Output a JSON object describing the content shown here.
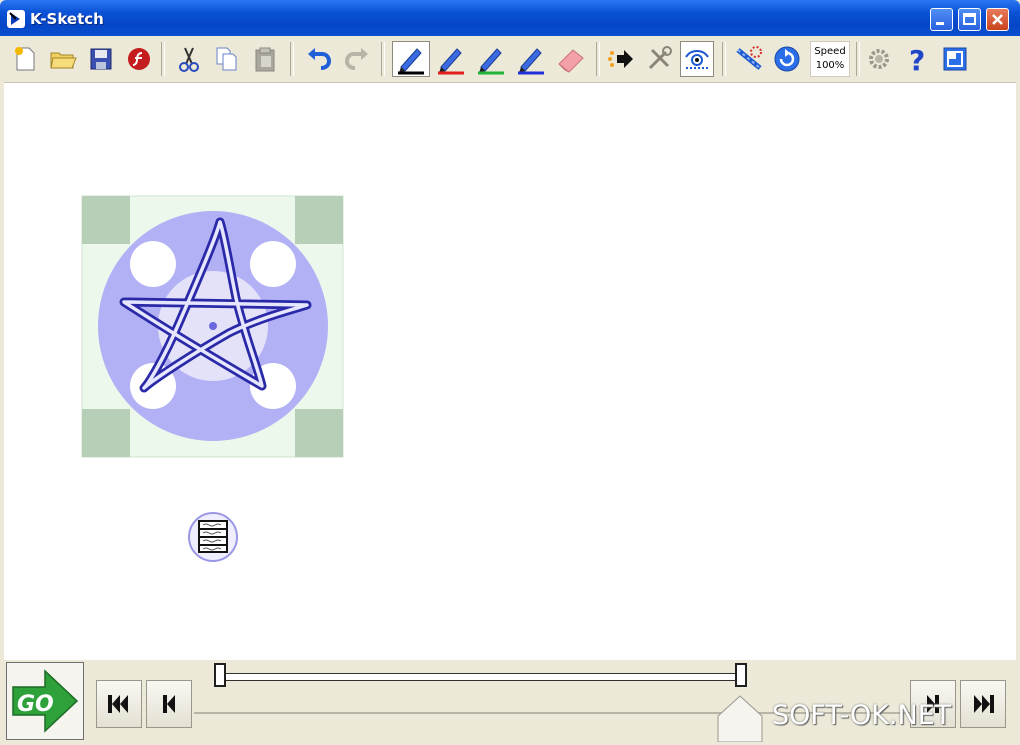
{
  "window": {
    "title": "K-Sketch"
  },
  "toolbar": {
    "buttons": [
      {
        "name": "new",
        "icon": "new-file-icon"
      },
      {
        "name": "open",
        "icon": "open-folder-icon"
      },
      {
        "name": "save",
        "icon": "save-disk-icon"
      },
      {
        "name": "export-flash",
        "icon": "flash-icon"
      },
      {
        "name": "cut",
        "icon": "scissors-icon"
      },
      {
        "name": "copy",
        "icon": "copy-icon"
      },
      {
        "name": "paste",
        "icon": "paste-icon"
      },
      {
        "name": "undo",
        "icon": "undo-icon"
      },
      {
        "name": "redo",
        "icon": "redo-icon"
      },
      {
        "name": "pen-black",
        "icon": "pen-black-icon"
      },
      {
        "name": "pen-red",
        "icon": "pen-red-icon"
      },
      {
        "name": "pen-green",
        "icon": "pen-green-icon"
      },
      {
        "name": "pen-blue",
        "icon": "pen-blue-icon"
      },
      {
        "name": "eraser",
        "icon": "eraser-icon"
      },
      {
        "name": "insert-key",
        "icon": "insert-arrow-icon"
      },
      {
        "name": "tools",
        "icon": "tools-icon"
      },
      {
        "name": "show-paths",
        "icon": "eye-path-icon"
      },
      {
        "name": "select-motion",
        "icon": "motion-icon"
      },
      {
        "name": "refresh",
        "icon": "refresh-icon"
      },
      {
        "name": "settings",
        "icon": "gear-icon"
      },
      {
        "name": "help",
        "icon": "help-icon"
      },
      {
        "name": "fullscreen",
        "icon": "fullscreen-icon"
      }
    ],
    "speed_label": "Speed",
    "speed_value": "100%"
  },
  "canvas": {
    "drawing": "star-sketch",
    "handle_colors": {
      "circle": "#b3b1f5",
      "square_bg": "#ecf8ec",
      "corner": "#b6cfb6",
      "stroke_outline": "#2a2aa8"
    }
  },
  "timeline": {
    "go_label": "GO",
    "progress": 1.0
  },
  "watermark": "SOFT-OK.NET",
  "colors": {
    "title_bar": "#0a52d6",
    "chrome": "#ece9d8",
    "go_green": "#2fa13a"
  }
}
